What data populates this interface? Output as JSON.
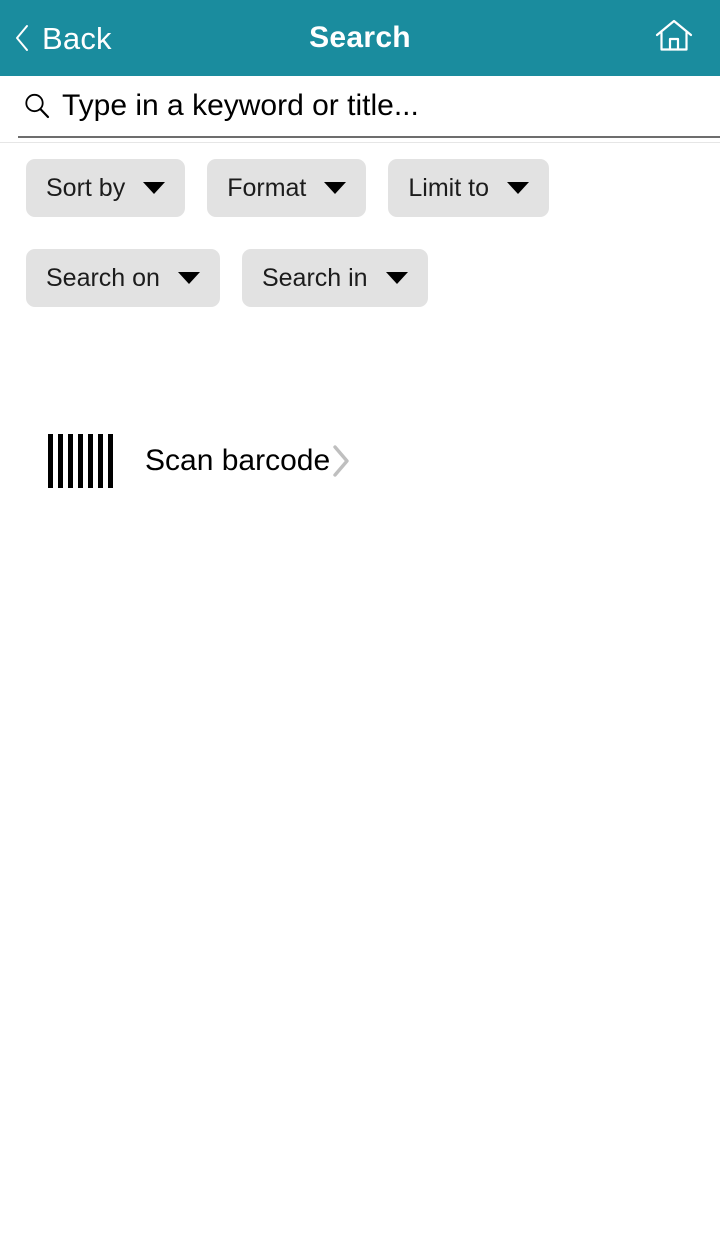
{
  "header": {
    "back_label": "Back",
    "title": "Search",
    "back_icon": "chevron-left-icon",
    "home_icon": "home-icon",
    "background_color": "#1a8c9e",
    "text_color": "#ffffff"
  },
  "search": {
    "placeholder": "Type in a keyword or title...",
    "value": "",
    "icon": "search-icon"
  },
  "filters": {
    "rows": [
      [
        {
          "label": "Sort by",
          "icon": "chevron-down-icon"
        },
        {
          "label": "Format",
          "icon": "chevron-down-icon"
        },
        {
          "label": "Limit to",
          "icon": "chevron-down-icon"
        }
      ],
      [
        {
          "label": "Search on",
          "icon": "chevron-down-icon"
        },
        {
          "label": "Search in",
          "icon": "chevron-down-icon"
        }
      ]
    ],
    "chip_background": "#e2e2e2",
    "chip_text_color": "#1c1c1c"
  },
  "scan": {
    "label": "Scan barcode",
    "icon": "barcode-icon",
    "chevron": "chevron-right-icon",
    "bar_count": 7,
    "chevron_color": "#bfbfbf"
  }
}
